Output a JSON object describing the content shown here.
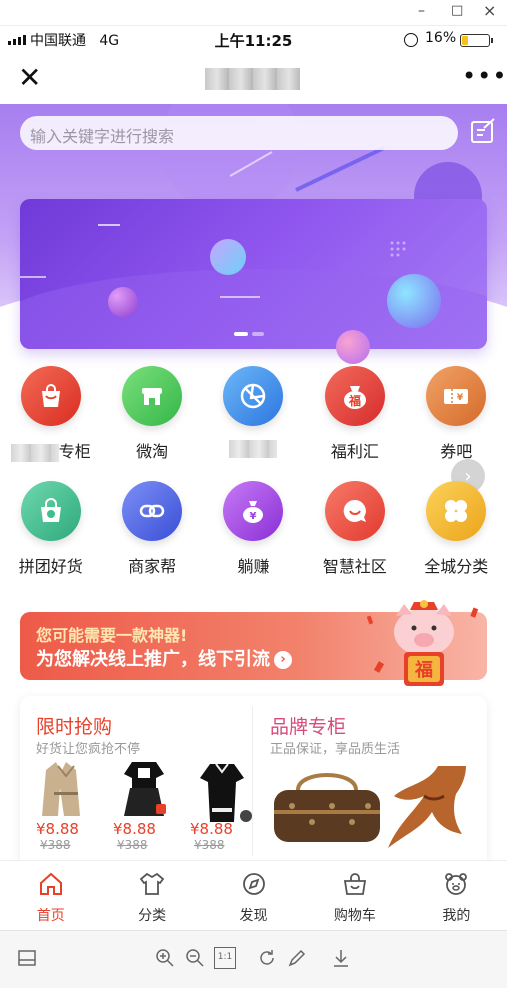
{
  "window": {
    "min": "–",
    "max": "□",
    "close": "×"
  },
  "status": {
    "carrier": "中国联通",
    "network": "4G",
    "time": "上午11:25",
    "battery": "16%"
  },
  "nav": {
    "close": "✕",
    "more": "•••"
  },
  "search": {
    "placeholder": "输入关键字进行搜索"
  },
  "grid": {
    "row1": [
      {
        "label": "专柜",
        "blurred_prefix": true,
        "icon": "shopping-bag-icon",
        "color": "#e8412a"
      },
      {
        "label": "微淘",
        "icon": "store-icon",
        "color": "#4cc65c"
      },
      {
        "label": "",
        "blurred_prefix": true,
        "icon": "aperture-icon",
        "color": "#3f8ee8"
      },
      {
        "label": "福利汇",
        "icon": "lucky-bag-icon",
        "color": "#e8412a"
      },
      {
        "label": "券吧",
        "icon": "coupon-icon",
        "color": "#e0803a"
      }
    ],
    "row2": [
      {
        "label": "拼团好货",
        "icon": "group-bag-icon",
        "color": "#3dbf8f"
      },
      {
        "label": "商家帮",
        "icon": "link-icon",
        "color": "#4e6de6"
      },
      {
        "label": "躺赚",
        "icon": "money-bag-icon",
        "color": "#9b3ee0"
      },
      {
        "label": "智慧社区",
        "icon": "chat-smile-icon",
        "color": "#ee4a3a"
      },
      {
        "label": "全城分类",
        "icon": "clover-icon",
        "color": "#f3b92a"
      }
    ]
  },
  "promo": {
    "line1": "您可能需要一款神器!",
    "line2": "为您解决线上推广，线下引流",
    "pig_char": "福"
  },
  "cards": {
    "left": {
      "title": "限时抢购",
      "subtitle": "好货让您疯抢不停",
      "items": [
        {
          "price": "¥8.88",
          "old": "¥388"
        },
        {
          "price": "¥8.88",
          "old": "¥388"
        },
        {
          "price": "¥8.88",
          "old": "¥388"
        }
      ]
    },
    "right": {
      "title": "品牌专柜",
      "subtitle": "正品保证，享品质生活"
    }
  },
  "tabs": [
    {
      "label": "首页",
      "icon": "home-icon",
      "active": true
    },
    {
      "label": "分类",
      "icon": "shirt-icon"
    },
    {
      "label": "发现",
      "icon": "compass-icon"
    },
    {
      "label": "购物车",
      "icon": "cart-icon"
    },
    {
      "label": "我的",
      "icon": "bear-icon"
    }
  ],
  "viewer": {
    "fit": "1:1"
  },
  "colors": {
    "accent": "#e8412a",
    "hero": "#a77ef0"
  }
}
